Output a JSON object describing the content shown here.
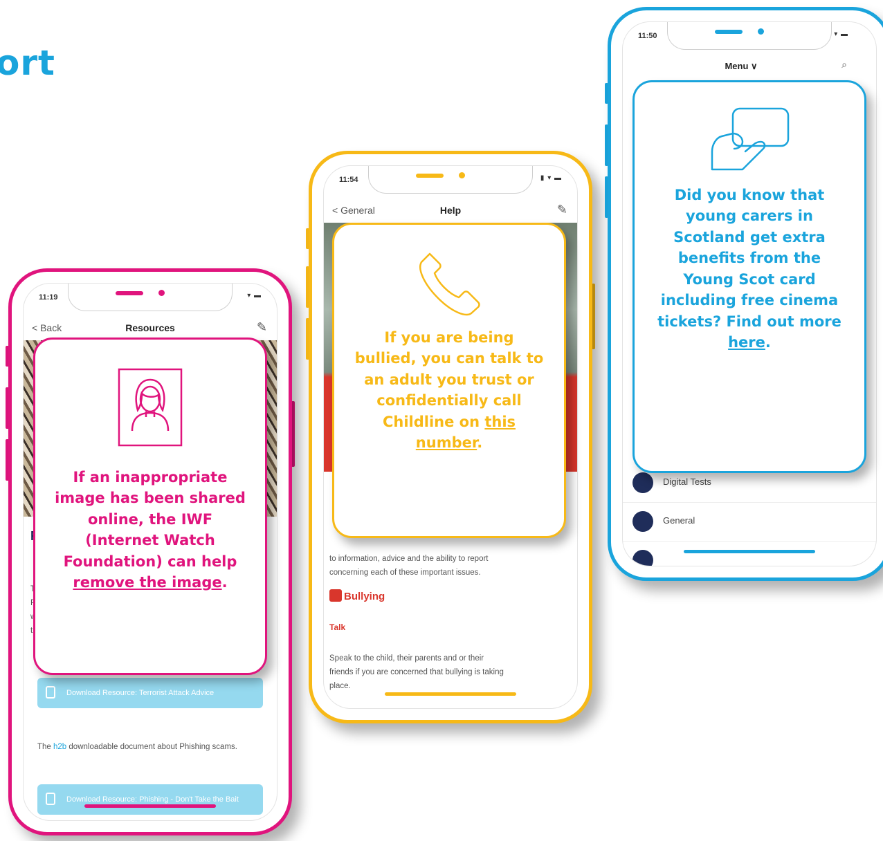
{
  "headline": "ort",
  "colors": {
    "pink": "#e0147d",
    "yellow": "#f7b917",
    "blue": "#1aa4dc"
  },
  "phone_pink": {
    "status_time": "11:19",
    "status_icons": "▾ ▬",
    "nav_back": "< Back",
    "nav_title": "Resources",
    "nav_icon": "compose-icon",
    "bg_lines": [
      "R",
      "Tl",
      "P",
      "w",
      "th"
    ],
    "download_1": "Download Resource: Terrorist Attack Advice",
    "body_text_pre": "The ",
    "body_text_link": "h2b",
    "body_text_post": " downloadable document about Phishing scams.",
    "download_2": "Download Resource: Phishing - Don't Take the Bait",
    "card_icon": "person-portrait-icon",
    "card_text": "If an inappropriate image has been shared online, the IWF (Internet Watch Foundation) can help ",
    "card_link": "remove the image",
    "card_end": "."
  },
  "phone_yellow": {
    "status_time": "11:54",
    "status_icons": "▮ ▾ ▬",
    "nav_back": "< General",
    "nav_title": "Help",
    "nav_icon": "compose-icon",
    "body_line_1": "to information, advice and the ability to report",
    "body_line_2": "concerning each of these important issues.",
    "bullying_heading": "Bullying",
    "talk_heading": "Talk",
    "speak_line_1": "Speak to the child, their parents and or their",
    "speak_line_2": "friends if you are concerned that bullying is taking",
    "speak_line_3": "place.",
    "card_icon": "phone-icon",
    "card_text": "If you are being bullied, you can talk to an adult you trust or confidentially call Childline on ",
    "card_link": "this number",
    "card_end": "."
  },
  "phone_blue": {
    "status_time": "11:50",
    "status_icons": "▮ ▾ ▬",
    "nav_title": "Menu ∨",
    "nav_icon": "search-icon",
    "menu_item_1": "Digital Tests",
    "menu_item_2": "General",
    "card_icon": "card-in-hand-icon",
    "card_text": "Did you know that young carers in Scotland get extra benefits from the Young Scot card including free cinema tickets? Find out more ",
    "card_link": "here",
    "card_end": "."
  }
}
